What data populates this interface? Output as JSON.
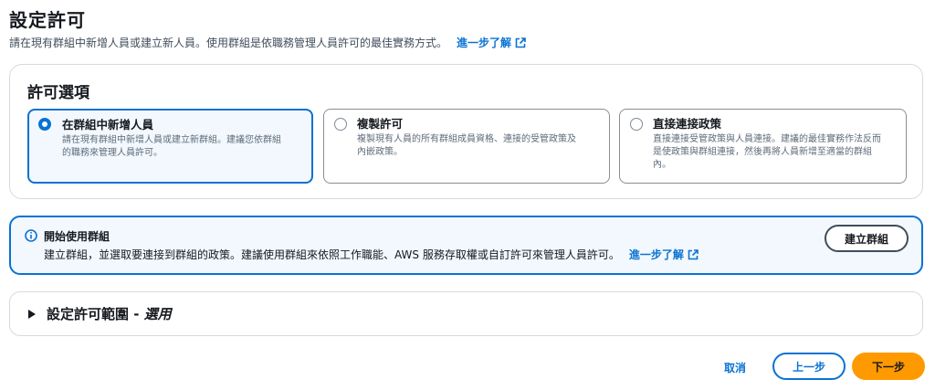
{
  "header": {
    "title": "設定許可",
    "description": "請在現有群組中新增人員或建立新人員。使用群組是依職務管理人員許可的最佳實務方式。",
    "learn_more": "進一步了解"
  },
  "permission_options": {
    "title": "許可選項",
    "selected_index": 0,
    "options": [
      {
        "title": "在群組中新增人員",
        "desc_line1": "請在現有群組中新增人員或建立新群組。建議您依群組",
        "desc_line2": "的職務來管理人員許可。"
      },
      {
        "title": "複製許可",
        "desc_line1": "複製現有人員的所有群組成員資格、連接的受管政策及",
        "desc_line2": "內嵌政策。"
      },
      {
        "title": "直接連接政策",
        "desc_line1": "直接連接受管政策與人員連接。建議的最佳實務作法反而",
        "desc_line2": "是使政策與群組連接，然後再將人員新增至適當的群組",
        "desc_line3": "內。"
      }
    ]
  },
  "info_alert": {
    "title": "開始使用群組",
    "body": "建立群組，並選取要連接到群組的政策。建議使用群組來依照工作職能、AWS 服務存取權或自訂許可來管理人員許可。",
    "learn_more": "進一步了解",
    "button_label": "建立群組",
    "icon": "info-icon"
  },
  "boundary_section": {
    "title": "設定許可範圍 - ",
    "suffix": "選用"
  },
  "footer": {
    "cancel": "取消",
    "previous": "上一步",
    "next": "下一步"
  },
  "colors": {
    "accent": "#0972d3",
    "primary_button": "#ff9900",
    "selected_bg": "#f2f8fd"
  }
}
